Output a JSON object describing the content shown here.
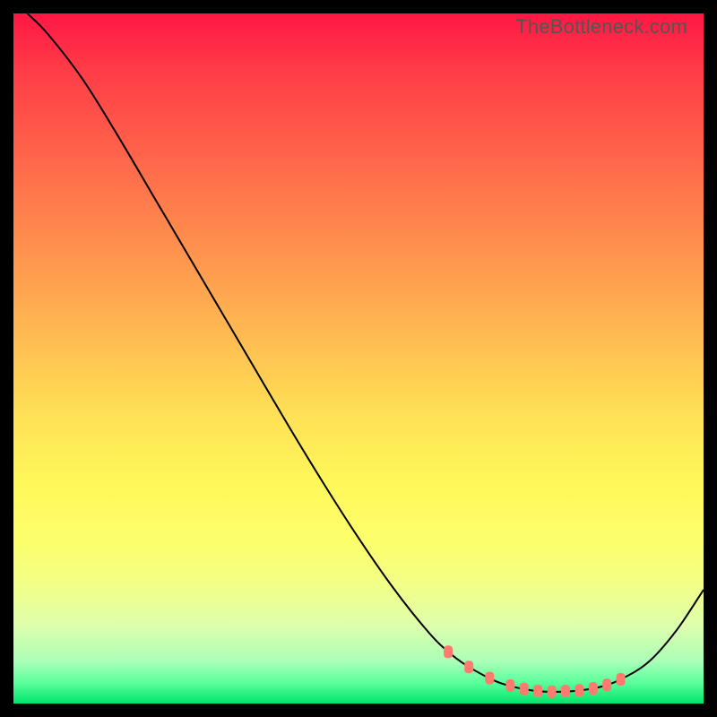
{
  "watermark": "TheBottleneck.com",
  "chart_data": {
    "type": "line",
    "title": "",
    "xlabel": "",
    "ylabel": "",
    "xlim": [
      0,
      100
    ],
    "ylim": [
      0,
      100
    ],
    "grid": false,
    "legend": false,
    "background_gradient": {
      "top": "#ff1744",
      "middle": "#ffe055",
      "bottom": "#00e56a"
    },
    "series": [
      {
        "name": "bottleneck-curve",
        "x": [
          2,
          5,
          10,
          15,
          20,
          25,
          30,
          35,
          40,
          45,
          50,
          55,
          60,
          63,
          66,
          70,
          73,
          76,
          79,
          82,
          85,
          88,
          92,
          96,
          100
        ],
        "y": [
          100,
          97,
          90.5,
          82.5,
          74,
          65.5,
          57,
          48.5,
          40,
          31.8,
          24,
          16.8,
          10.5,
          7.5,
          5.3,
          3.2,
          2.3,
          1.8,
          1.7,
          1.9,
          2.4,
          3.5,
          6,
          10.5,
          16.5
        ]
      }
    ],
    "markers": {
      "name": "highlight-points",
      "x": [
        63,
        66,
        69,
        72,
        74,
        76,
        78,
        80,
        82,
        84,
        86,
        88
      ],
      "y": [
        7.5,
        5.3,
        3.7,
        2.6,
        2.1,
        1.8,
        1.7,
        1.8,
        1.9,
        2.2,
        2.7,
        3.5
      ]
    }
  }
}
